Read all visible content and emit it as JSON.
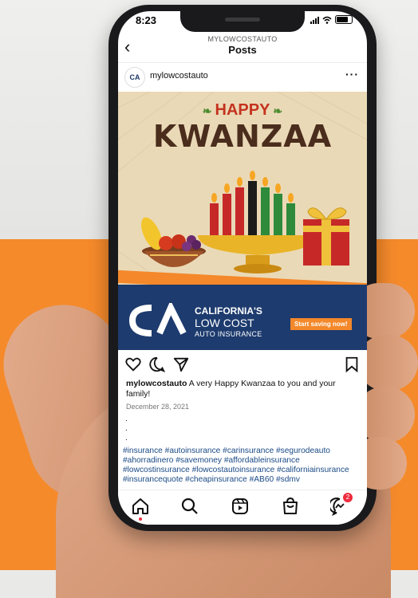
{
  "status": {
    "time": "8:23"
  },
  "header": {
    "account": "MYLOWCOSTAUTO",
    "title": "Posts",
    "back_icon": "chevron-left-icon"
  },
  "post": {
    "username": "mylowcostauto",
    "avatar_text": "CA",
    "more_icon": "more-horizontal-icon",
    "image": {
      "happy": "HAPPY",
      "kwanzaa": "KWANZAA",
      "brand_line1": "CALIFORNIA'S",
      "brand_line2": "LOW COST",
      "brand_line3": "AUTO INSURANCE",
      "cta": "Start saving now!",
      "candle_colors": [
        "#c62828",
        "#c62828",
        "#c62828",
        "#1b1b1b",
        "#2e8b3c",
        "#2e8b3c",
        "#2e8b3c"
      ]
    },
    "caption_user": "mylowcostauto",
    "caption_text": "A very Happy Kwanzaa to you and your family!",
    "date": "December 28, 2021",
    "dots": [
      ".",
      ".",
      "."
    ],
    "hashtags": "#insurance #autoinsurance #carinsurance #segurodeauto #ahorradinero #savemoney #affordableinsurance #lowcostinsurance #lowcostautoinsurance #californiainsurance #insurancequote #cheapinsurance #AB60 #sdmv"
  },
  "actions": {
    "like_icon": "heart-icon",
    "comment_icon": "comment-icon",
    "share_icon": "send-icon",
    "save_icon": "bookmark-icon"
  },
  "tabbar": {
    "home_icon": "home-icon",
    "search_icon": "search-icon",
    "reels_icon": "reels-icon",
    "shop_icon": "shop-icon",
    "messages_icon": "messenger-icon",
    "messages_badge": "2"
  },
  "colors": {
    "orange": "#f58a2b",
    "navy": "#1d3b6e",
    "link": "#1a4a86"
  }
}
